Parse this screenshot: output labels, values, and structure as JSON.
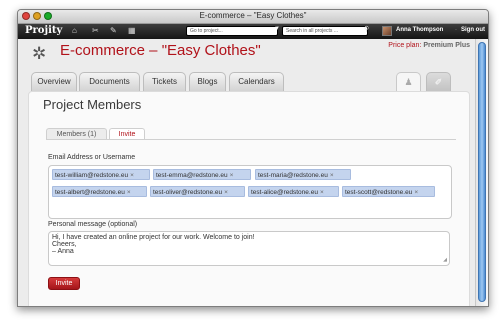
{
  "window": {
    "title": "E-commerce – \"Easy Clothes\""
  },
  "appbar": {
    "logo": "Projity",
    "goto_placeholder": "Go to project...",
    "search_placeholder": "Search in all projects ...",
    "user_name": "Anna Thompson",
    "separator": "·",
    "signout_label": "Sign out"
  },
  "project": {
    "title": "E-commerce – \"Easy Clothes\"",
    "price_label": "Price plan:",
    "price_plan": "Premium Plus"
  },
  "tabs": [
    "Overview",
    "Documents",
    "Tickets",
    "Blogs",
    "Calendars"
  ],
  "card": {
    "title": "Project Members",
    "subtabs": [
      "Members (1)",
      "Invite"
    ]
  },
  "form": {
    "email_label": "Email Address or Username",
    "emails": [
      "test-william@redstone.eu",
      "test-emma@redstone.eu",
      "test-maria@redstone.eu",
      "test-albert@redstone.eu",
      "test-oliver@redstone.eu",
      "test-alice@redstone.eu",
      "test-scott@redstone.eu"
    ],
    "chip_remove": "×",
    "message_label": "Personal message (optional)",
    "message_lines": [
      "Hi, I have created an online project for our work. Welcome to join!",
      "Cheers,",
      "– Anna"
    ],
    "invite_button": "Invite"
  },
  "colors": {
    "accent": "#b1121a",
    "chip_bg": "#c4d4ee",
    "appbar": "#1e1e1e",
    "scroll_thumb": "#6aa6e3"
  }
}
